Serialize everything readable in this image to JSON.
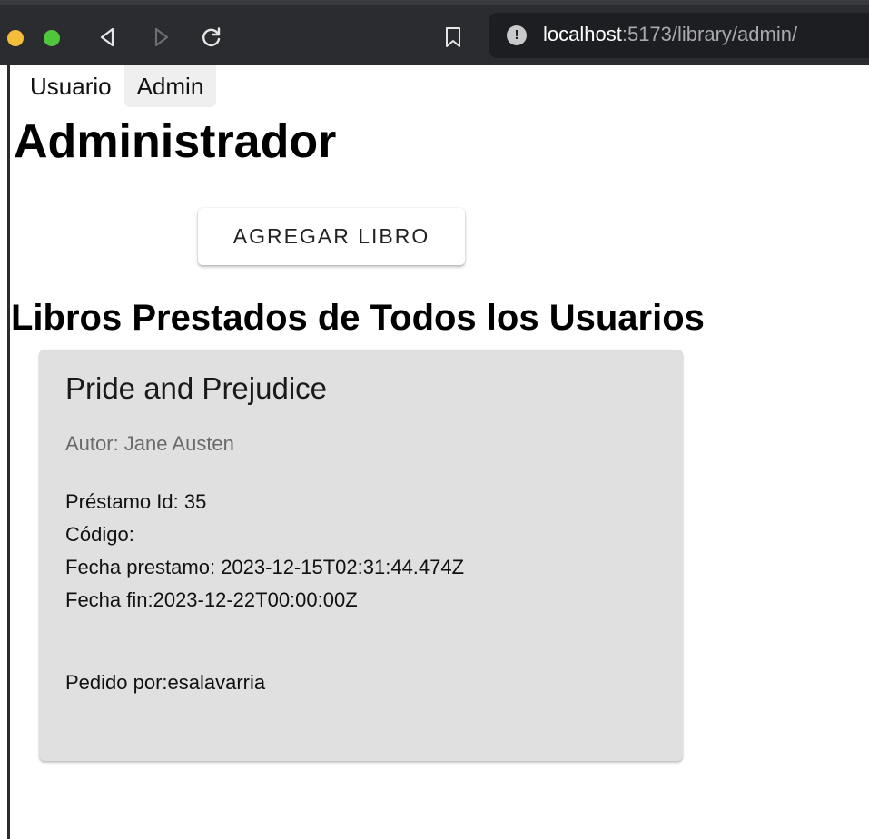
{
  "browser": {
    "url_host": "localhost",
    "url_rest": ":5173/library/admin/",
    "site_info_glyph": "!",
    "icons": [
      "chevron-left-icon",
      "chevron-right-icon",
      "reload-icon",
      "bookmark-icon",
      "info-icon"
    ]
  },
  "nav": {
    "tabs": [
      {
        "label": "Usuario",
        "active": false
      },
      {
        "label": "Admin",
        "active": true
      }
    ]
  },
  "page": {
    "title": "Administrador",
    "add_button": "AGREGAR LIBRO",
    "section_title": "Libros Prestados de Todos los Usuarios"
  },
  "loans": [
    {
      "title": "Pride and Prejudice",
      "author": "Autor: Jane Austen",
      "loan_id": "Préstamo Id: 35",
      "code": "Código:",
      "loan_date": "Fecha prestamo: 2023-12-15T02:31:44.474Z",
      "end_date": "Fecha fin:2023-12-22T00:00:00Z",
      "requested_by": "Pedido por:esalavarria"
    }
  ],
  "colors": {
    "chrome_bg": "#2b2c30",
    "urlbar_bg": "#1d1e22",
    "card_bg": "#e0e0e0",
    "tab_active_bg": "#efefef"
  }
}
